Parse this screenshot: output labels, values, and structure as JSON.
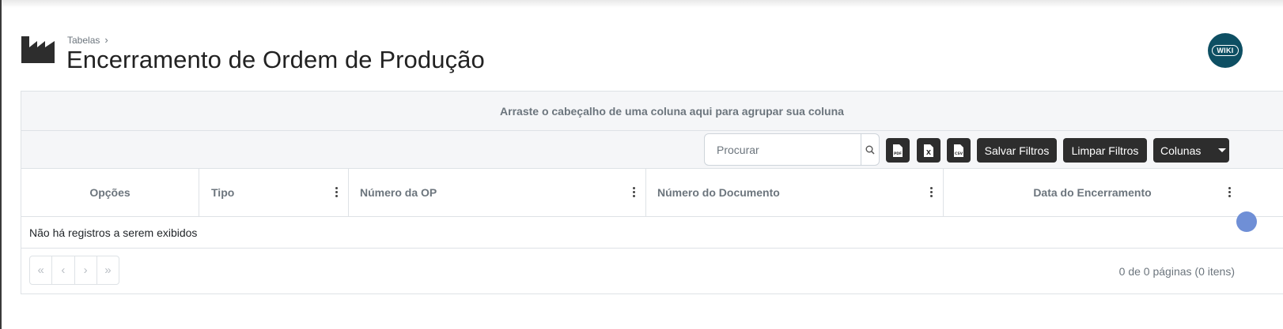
{
  "header": {
    "breadcrumb": "Tabelas",
    "title": "Encerramento de Ordem de Produção",
    "wiki_label": "WIKI",
    "page_icon": "factory-icon"
  },
  "grid": {
    "group_panel_text": "Arraste o cabeçalho de uma coluna aqui para agrupar sua coluna",
    "search_placeholder": "Procurar",
    "search_value": "",
    "export_buttons": [
      {
        "name": "pdf-export-icon",
        "label": "PDF"
      },
      {
        "name": "excel-export-icon",
        "label": "X"
      },
      {
        "name": "csv-export-icon",
        "label": "CSV"
      }
    ],
    "save_filters_label": "Salvar Filtros",
    "clear_filters_label": "Limpar Filtros",
    "columns_label": "Colunas",
    "columns": [
      "Opções",
      "Tipo",
      "Número da OP",
      "Número do Documento",
      "Data do Encerramento"
    ],
    "empty_message": "Não há registros a serem exibidos",
    "pager_buttons": [
      "«",
      "‹",
      "›",
      "»"
    ],
    "pager_info": "0 de 0 páginas (0 itens)"
  },
  "colors": {
    "dark_button": "#2d2d2d",
    "wiki_bg": "#0e4f63",
    "panel_bg": "#f5f6f8",
    "fab": "#6f8fd6"
  }
}
